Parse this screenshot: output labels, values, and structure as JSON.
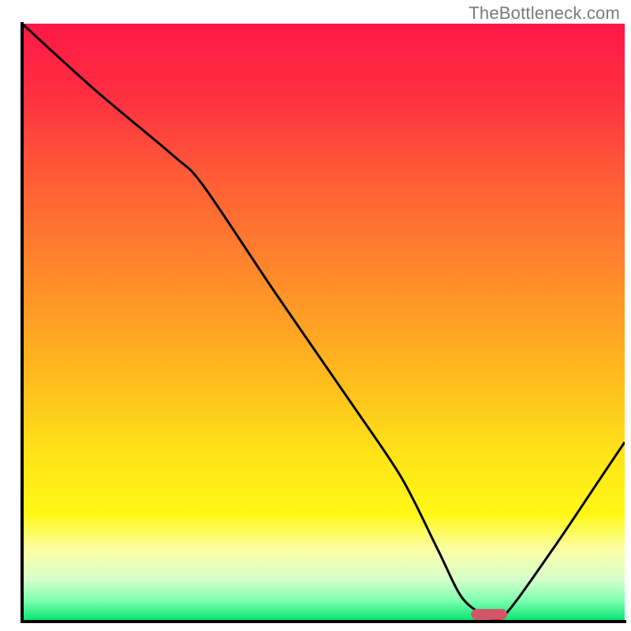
{
  "watermark": "TheBottleneck.com",
  "chart_data": {
    "type": "line",
    "title": "",
    "xlabel": "",
    "ylabel": "",
    "xlim": [
      0,
      100
    ],
    "ylim": [
      0,
      100
    ],
    "grid": false,
    "gradient": {
      "stops": [
        {
          "offset": 0.0,
          "color": "#ff1846"
        },
        {
          "offset": 0.12,
          "color": "#ff2f41"
        },
        {
          "offset": 0.25,
          "color": "#ff5a37"
        },
        {
          "offset": 0.38,
          "color": "#ff7e2e"
        },
        {
          "offset": 0.5,
          "color": "#ffa024"
        },
        {
          "offset": 0.62,
          "color": "#ffc41c"
        },
        {
          "offset": 0.72,
          "color": "#ffe317"
        },
        {
          "offset": 0.82,
          "color": "#fff815"
        },
        {
          "offset": 0.88,
          "color": "#fbffa6"
        },
        {
          "offset": 0.93,
          "color": "#d6ffca"
        },
        {
          "offset": 0.965,
          "color": "#7dffb0"
        },
        {
          "offset": 1.0,
          "color": "#00e36e"
        }
      ]
    },
    "series": [
      {
        "name": "bottleneck-curve",
        "type": "line",
        "color": "#000000",
        "x": [
          0,
          12,
          25,
          30,
          42,
          55,
          63,
          69,
          73,
          77,
          80,
          88,
          96,
          100
        ],
        "y": [
          100,
          89,
          78,
          73,
          55,
          36,
          24,
          12,
          4,
          1,
          1,
          12,
          24,
          30
        ]
      }
    ],
    "marker": {
      "name": "optimal-zone",
      "shape": "capsule",
      "color": "#d4556a",
      "x_center": 77.5,
      "y_center": 1.2,
      "width": 6.0,
      "height": 1.8
    },
    "axes": {
      "color": "#000000",
      "thickness_px": 4
    }
  }
}
